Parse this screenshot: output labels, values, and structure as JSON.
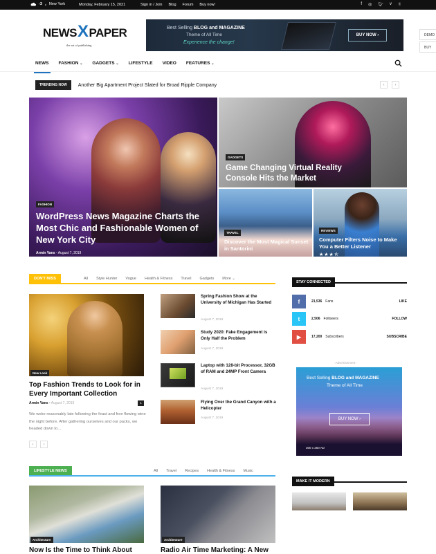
{
  "topbar": {
    "weather_icon": "cloud-icon",
    "temp": "-3",
    "temp_unit": "c",
    "city": "New York",
    "date": "Monday, February 15, 2021",
    "links": [
      "Sign in / Join",
      "Blog",
      "Forum",
      "Buy now!"
    ],
    "social_icons": [
      "facebook-icon",
      "instagram-icon",
      "twitter-icon",
      "vimeo-icon",
      "vk-icon"
    ]
  },
  "header": {
    "logo_left": "NEWS",
    "logo_x": "X",
    "logo_right": "PAPER",
    "tagline": "the art of publishing",
    "banner": {
      "line1_pre": "Best Selling ",
      "line1_bold": "BLOG and MAGAZINE",
      "line2": "Theme of All Time",
      "line3": "Experience the change!",
      "button": "BUY NOW"
    },
    "side_buttons": [
      "DEMO",
      "BUY"
    ]
  },
  "nav": {
    "items": [
      {
        "label": "NEWS",
        "dropdown": false,
        "active": true
      },
      {
        "label": "FASHION",
        "dropdown": true,
        "active": false
      },
      {
        "label": "GADGETS",
        "dropdown": true,
        "active": false
      },
      {
        "label": "LIFESTYLE",
        "dropdown": false,
        "active": false
      },
      {
        "label": "VIDEO",
        "dropdown": false,
        "active": false
      },
      {
        "label": "FEATURES",
        "dropdown": true,
        "active": false
      }
    ]
  },
  "trending": {
    "label": "TRENDING NOW",
    "headline": "Another Big Apartment Project Slated for Broad Ripple Company"
  },
  "hero": {
    "main": {
      "tag": "FASHION",
      "title": "WordPress News Magazine Charts the Most Chic and Fashionable Women of New York City",
      "author": "Armin Vans",
      "date": "August 7, 2019"
    },
    "top_right": {
      "tag": "GADGETS",
      "title": "Game Changing Virtual Reality Console Hits the Market"
    },
    "bottom_left": {
      "tag": "TRAVEL",
      "title": "Discover the Most Magical Sunset in Santorini"
    },
    "bottom_right": {
      "tag": "REVIEWS",
      "title": "Computer Filters Noise to Make You a Better Listener",
      "rating": 3.5
    }
  },
  "dont_miss": {
    "label": "DON'T MISS",
    "filters": [
      "All",
      "Style Hunter",
      "Vogue",
      "Health & Fitness",
      "Travel",
      "Gadgets",
      "More"
    ],
    "main": {
      "tag": "New Look",
      "title": "Top Fashion Trends to Look for in Every Important Collection",
      "author": "Armin Vans",
      "date": "August 7, 2019",
      "comments": "1",
      "excerpt": "We woke reasonably late following the feast and free flowing wine the night before. After gathering ourselves and our packs, we headed down to..."
    },
    "list": [
      {
        "title": "Spring Fashion Show at the University of Michigan Has Started",
        "date": "August 7, 2019"
      },
      {
        "title": "Study 2020: Fake Engagement is Only Half the Problem",
        "date": "August 7, 2019"
      },
      {
        "title": "Laptop with 128-bit Processor, 32GB of RAM and 24MP Front Camera",
        "date": "August 7, 2019"
      },
      {
        "title": "Flying Over the Grand Canyon with a Helicopter",
        "date": "August 7, 2019"
      }
    ]
  },
  "stay_connected": {
    "label": "STAY CONNECTED",
    "rows": [
      {
        "icon": "facebook-icon",
        "count": "21,536",
        "name": "Fans",
        "action": "LIKE",
        "color": "#516eab"
      },
      {
        "icon": "twitter-icon",
        "count": "2,506",
        "name": "Followers",
        "action": "FOLLOW",
        "color": "#29c5f6"
      },
      {
        "icon": "youtube-icon",
        "count": "17,200",
        "name": "Subscribers",
        "action": "SUBSCRIBE",
        "color": "#e14e42"
      }
    ]
  },
  "ad": {
    "label": "- Advertisement -",
    "line1_pre": "Best Selling ",
    "line1_bold": "BLOG and MAGAZINE",
    "line2": "Theme of All Time",
    "button": "BUY NOW",
    "size": "300 x 250 AD"
  },
  "lifestyle": {
    "label": "LIFESTYLE NEWS",
    "filters": [
      "All",
      "Travel",
      "Recipes",
      "Health & Fitness",
      "Music"
    ],
    "cards": [
      {
        "tag": "Architecture",
        "title": "Now Is the Time to Think About"
      },
      {
        "tag": "Architecture",
        "title": "Radio Air Time Marketing: A New"
      }
    ]
  },
  "make_it_modern": {
    "label": "MAKE IT MODERN"
  },
  "colors": {
    "accent_blue": "#1e73be",
    "dont_miss_yellow": "#ffc107",
    "lifestyle_green": "#4db2ec"
  }
}
